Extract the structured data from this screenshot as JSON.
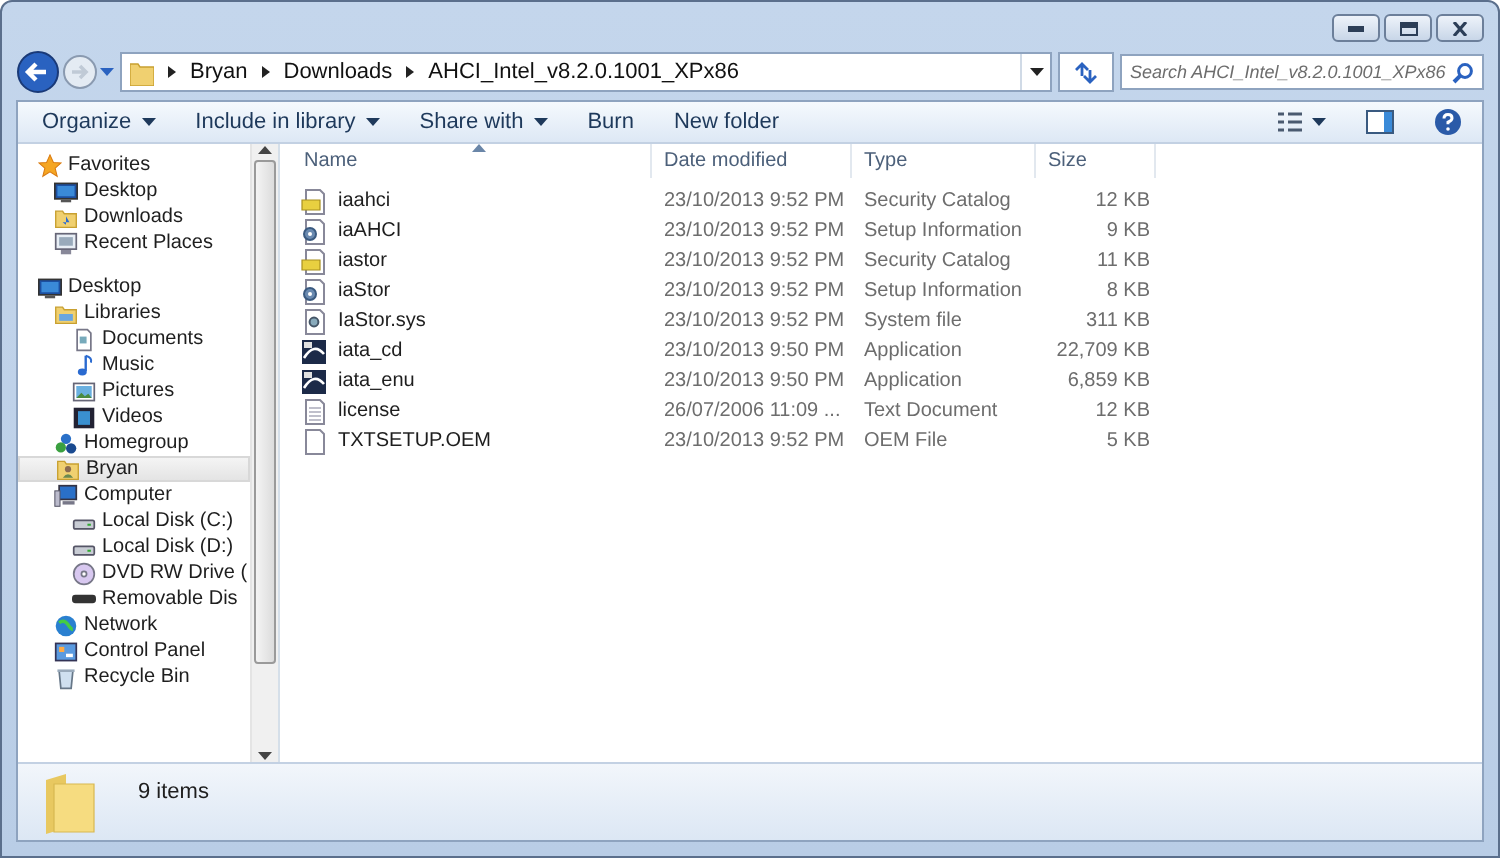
{
  "address": {
    "breadcrumbs": [
      "Bryan",
      "Downloads",
      "AHCI_Intel_v8.2.0.1001_XPx86"
    ]
  },
  "search": {
    "placeholder": "Search AHCI_Intel_v8.2.0.1001_XPx86"
  },
  "toolbar": {
    "buttons": [
      {
        "label": "Organize",
        "dropdown": true
      },
      {
        "label": "Include in library",
        "dropdown": true
      },
      {
        "label": "Share with",
        "dropdown": true
      },
      {
        "label": "Burn",
        "dropdown": false
      },
      {
        "label": "New folder",
        "dropdown": false
      }
    ]
  },
  "nav": {
    "sections": [
      {
        "label": "Favorites",
        "kind": "star",
        "selected": false,
        "children": [
          {
            "label": "Desktop",
            "kind": "desktop",
            "selected": false
          },
          {
            "label": "Downloads",
            "kind": "folder",
            "selected": false
          },
          {
            "label": "Recent Places",
            "kind": "recent",
            "selected": false
          }
        ]
      },
      {
        "label": "Desktop",
        "kind": "desktop",
        "selected": false,
        "children": [
          {
            "label": "Libraries",
            "kind": "library",
            "selected": false,
            "children": [
              {
                "label": "Documents",
                "kind": "document",
                "selected": false
              },
              {
                "label": "Music",
                "kind": "music",
                "selected": false
              },
              {
                "label": "Pictures",
                "kind": "picture",
                "selected": false
              },
              {
                "label": "Videos",
                "kind": "video",
                "selected": false
              }
            ]
          },
          {
            "label": "Homegroup",
            "kind": "homegroup",
            "selected": false
          },
          {
            "label": "Bryan",
            "kind": "user",
            "selected": true
          },
          {
            "label": "Computer",
            "kind": "computer",
            "selected": false,
            "children": [
              {
                "label": "Local Disk (C:)",
                "kind": "disk",
                "selected": false
              },
              {
                "label": "Local Disk (D:)",
                "kind": "disk",
                "selected": false
              },
              {
                "label": "DVD RW Drive (",
                "kind": "dvd",
                "selected": false
              },
              {
                "label": "Removable Dis",
                "kind": "removable",
                "selected": false
              }
            ]
          },
          {
            "label": "Network",
            "kind": "network",
            "selected": false
          },
          {
            "label": "Control Panel",
            "kind": "control",
            "selected": false
          },
          {
            "label": "Recycle Bin",
            "kind": "recycle",
            "selected": false
          }
        ]
      }
    ]
  },
  "file_list": {
    "columns": [
      {
        "label": "Name",
        "sorted": true
      },
      {
        "label": "Date modified",
        "sorted": false
      },
      {
        "label": "Type",
        "sorted": false
      },
      {
        "label": "Size",
        "sorted": false
      }
    ],
    "rows": [
      {
        "name": "iaahci",
        "kind": "catalog",
        "date": "23/10/2013 9:52 PM",
        "type": "Security Catalog",
        "size": "12 KB"
      },
      {
        "name": "iaAHCI",
        "kind": "setup",
        "date": "23/10/2013 9:52 PM",
        "type": "Setup Information",
        "size": "9 KB"
      },
      {
        "name": "iastor",
        "kind": "catalog",
        "date": "23/10/2013 9:52 PM",
        "type": "Security Catalog",
        "size": "11 KB"
      },
      {
        "name": "iaStor",
        "kind": "setup",
        "date": "23/10/2013 9:52 PM",
        "type": "Setup Information",
        "size": "8 KB"
      },
      {
        "name": "IaStor.sys",
        "kind": "system",
        "date": "23/10/2013 9:52 PM",
        "type": "System file",
        "size": "311 KB"
      },
      {
        "name": "iata_cd",
        "kind": "application",
        "date": "23/10/2013 9:50 PM",
        "type": "Application",
        "size": "22,709 KB"
      },
      {
        "name": "iata_enu",
        "kind": "application",
        "date": "23/10/2013 9:50 PM",
        "type": "Application",
        "size": "6,859 KB"
      },
      {
        "name": "license",
        "kind": "text",
        "date": "26/07/2006 11:09 ...",
        "type": "Text Document",
        "size": "12 KB"
      },
      {
        "name": "TXTSETUP.OEM",
        "kind": "blank",
        "date": "23/10/2013 9:52 PM",
        "type": "OEM File",
        "size": "5 KB"
      }
    ]
  },
  "status_bar": {
    "text": "9 items"
  }
}
